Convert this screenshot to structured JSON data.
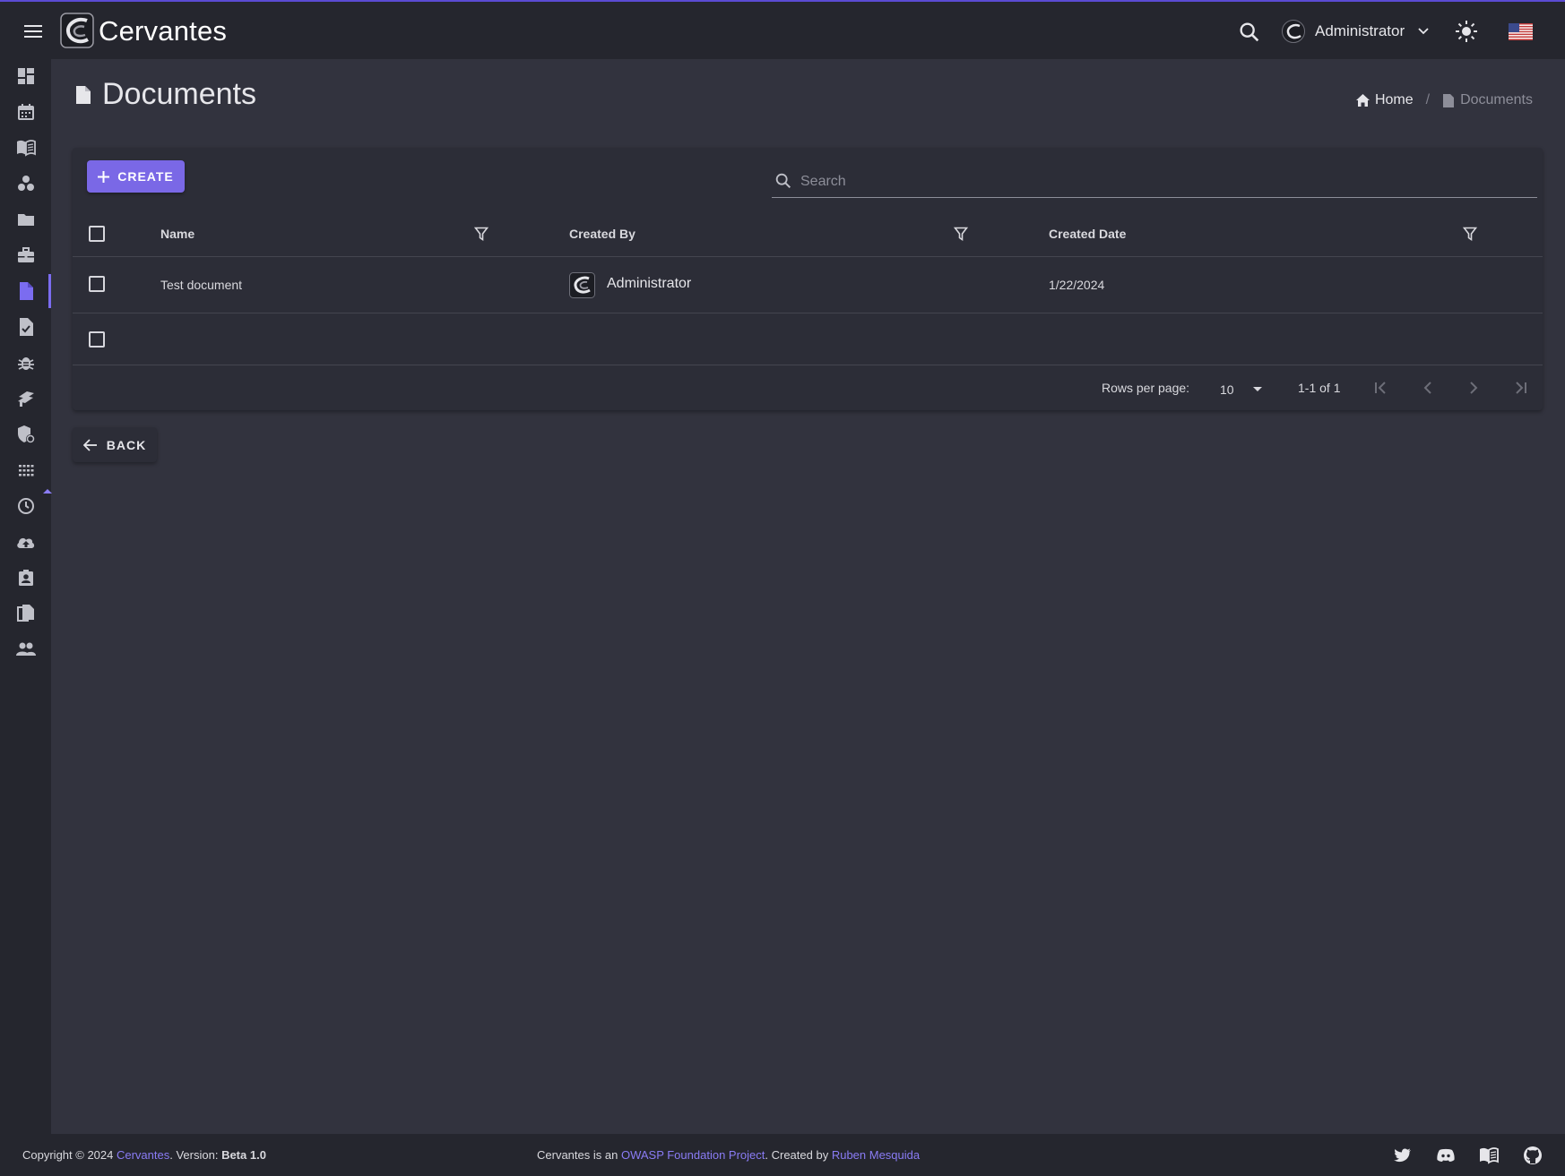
{
  "app": {
    "brand": "Cervantes",
    "user_name": "Administrator"
  },
  "page": {
    "title": "Documents"
  },
  "breadcrumb": {
    "home": "Home",
    "separator": "/",
    "current": "Documents"
  },
  "toolbar": {
    "create_label": "CREATE",
    "search_placeholder": "Search"
  },
  "table": {
    "columns": [
      "Name",
      "Created By",
      "Created Date"
    ],
    "rows": [
      {
        "name": "Test document",
        "created_by": "Administrator",
        "created_date": "1/22/2024"
      }
    ]
  },
  "pagination": {
    "rows_per_page_label": "Rows per page:",
    "rows_per_page": "10",
    "range": "1-1 of 1"
  },
  "back": {
    "label": "BACK"
  },
  "footer": {
    "copyright": "Copyright © 2024",
    "brand_link": "Cervantes",
    "version_prefix": ". Version:",
    "version": "Beta 1.0",
    "owasp_prefix": "Cervantes is an",
    "owasp_link": "OWASP Foundation Project",
    "created_by_prefix": ". Created by",
    "author_link": "Ruben Mesquida"
  },
  "sidebar": {
    "icons": [
      "dashboard-icon",
      "calendar-icon",
      "book-icon",
      "workspaces-icon",
      "folder-icon",
      "briefcase-icon",
      "document-icon",
      "checklist-icon",
      "bug-icon",
      "vulnerabilities-icon",
      "security-icon",
      "apps-icon",
      "history-icon",
      "upload-icon",
      "contact-icon",
      "copy-icon",
      "users-icon"
    ],
    "active_index": 6
  },
  "colors": {
    "accent": "#7a68e6",
    "link": "#8a7cf5",
    "background": "#32333e",
    "surface": "#2c2d37",
    "bar": "#25262e"
  }
}
